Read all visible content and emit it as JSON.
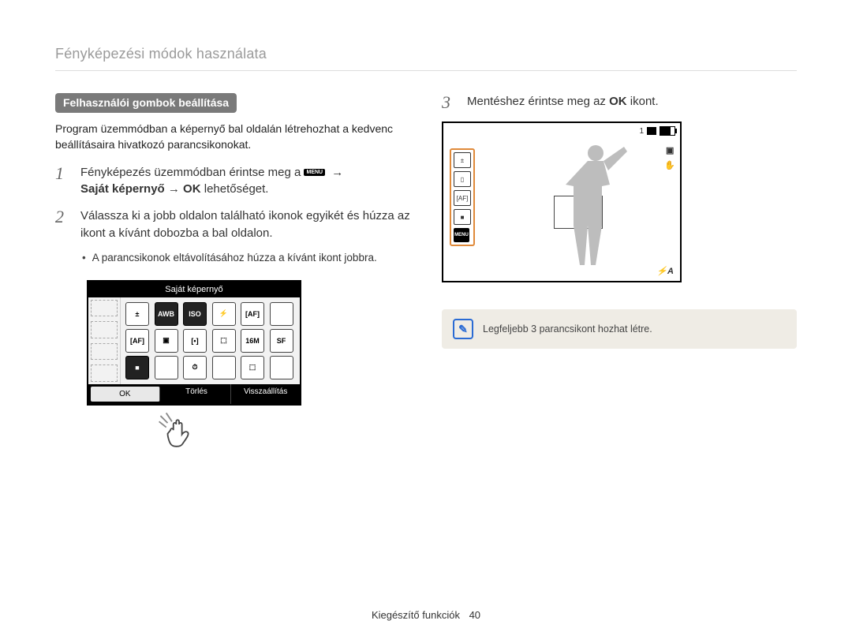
{
  "chapter_title": "Fényképezési módok használata",
  "subhead": "Felhasználói gombok beállítása",
  "intro": "Program üzemmódban a képernyő bal oldalán létrehozhat a kedvenc beállításaira hivatkozó parancsikonokat.",
  "steps": {
    "s1_part1": "Fényképezés üzemmódban érintse meg a ",
    "s1_arrow": "→",
    "s1_strong": "Saját képernyő → OK",
    "s1_part2": " lehetőséget.",
    "s2": "Válassza ki a jobb oldalon található ikonok egyikét és húzza az ikont a kívánt dobozba a bal oldalon.",
    "s2_bullet": "A parancsikonok eltávolításához húzza a kívánt ikont jobbra.",
    "s3_part1": "Mentéshez érintse meg az ",
    "s3_strong": "OK",
    "s3_part2": " ikont."
  },
  "menu_chip": "MENU",
  "shot1": {
    "title": "Saját képernyő",
    "grid_labels": [
      "±",
      "AWB",
      "ISO",
      "⚡",
      "[AF]",
      "",
      "[AF]",
      "▣",
      "[•]",
      "⬚",
      "16M",
      "SF",
      "■",
      "",
      "⏱",
      "",
      "⬚",
      ""
    ],
    "buttons": {
      "ok": "OK",
      "delete": "Törlés",
      "reset": "Visszaállítás"
    }
  },
  "shot2": {
    "counter": "1",
    "side_icons": [
      "±",
      "▯",
      "[AF]",
      "■"
    ],
    "side_menu": "MENU",
    "right_icons": [
      "▣",
      "✋"
    ],
    "br": "⚡A"
  },
  "note": "Legfeljebb 3 parancsikont hozhat létre.",
  "footer_label": "Kiegészítő funkciók",
  "page_number": "40"
}
